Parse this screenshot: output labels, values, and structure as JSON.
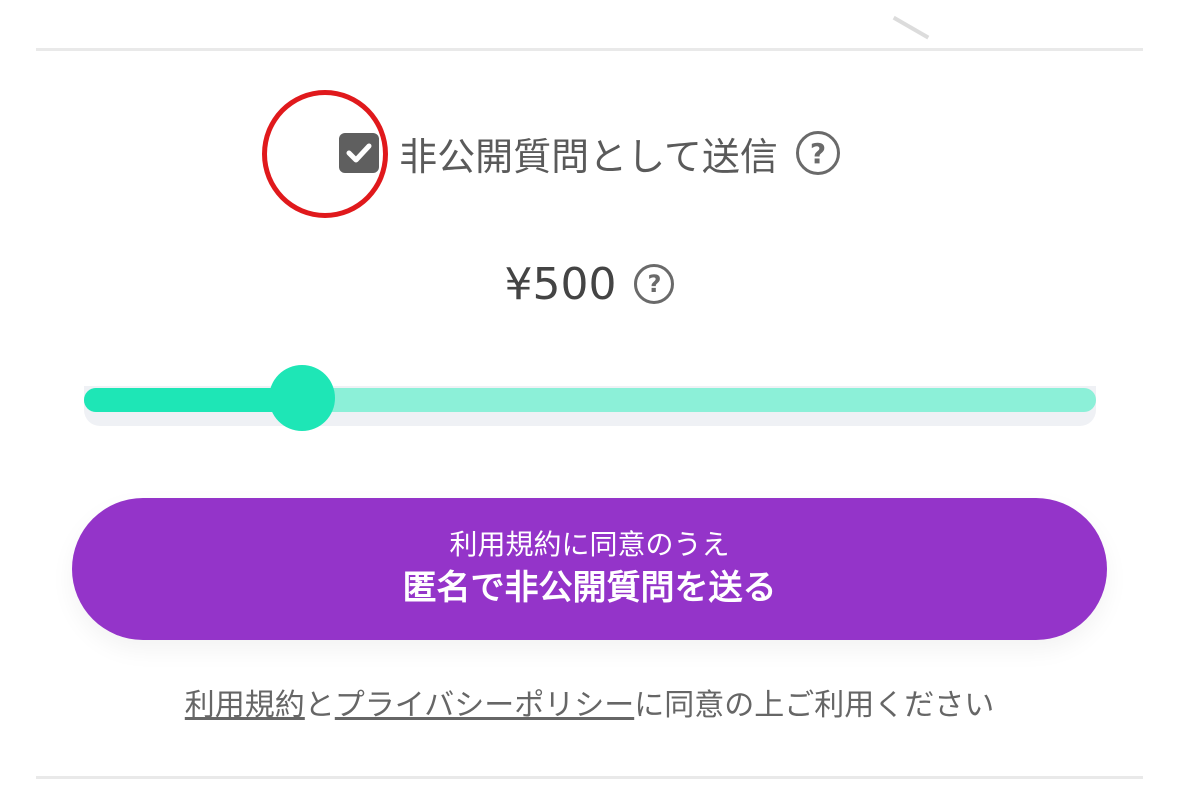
{
  "private_option": {
    "label": "非公開質問として送信",
    "checked": true,
    "check_icon": "check-icon",
    "help_icon": "question-circle-icon",
    "help_glyph": "?"
  },
  "price": {
    "value": "¥500",
    "help_icon": "question-circle-icon",
    "help_glyph": "?"
  },
  "slider": {
    "fill_fraction": 0.215,
    "track_color": "#8cf0d8",
    "fill_color": "#1ee6b6"
  },
  "submit_button": {
    "line1": "利用規約に同意のうえ",
    "line2": "匿名で非公開質問を送る",
    "color": "#9434c9"
  },
  "agreement": {
    "terms_link": "利用規約",
    "connector": "と",
    "privacy_link": "プライバシーポリシー",
    "suffix": "に同意の上ご利用ください"
  },
  "highlight_color": "#e0191c"
}
